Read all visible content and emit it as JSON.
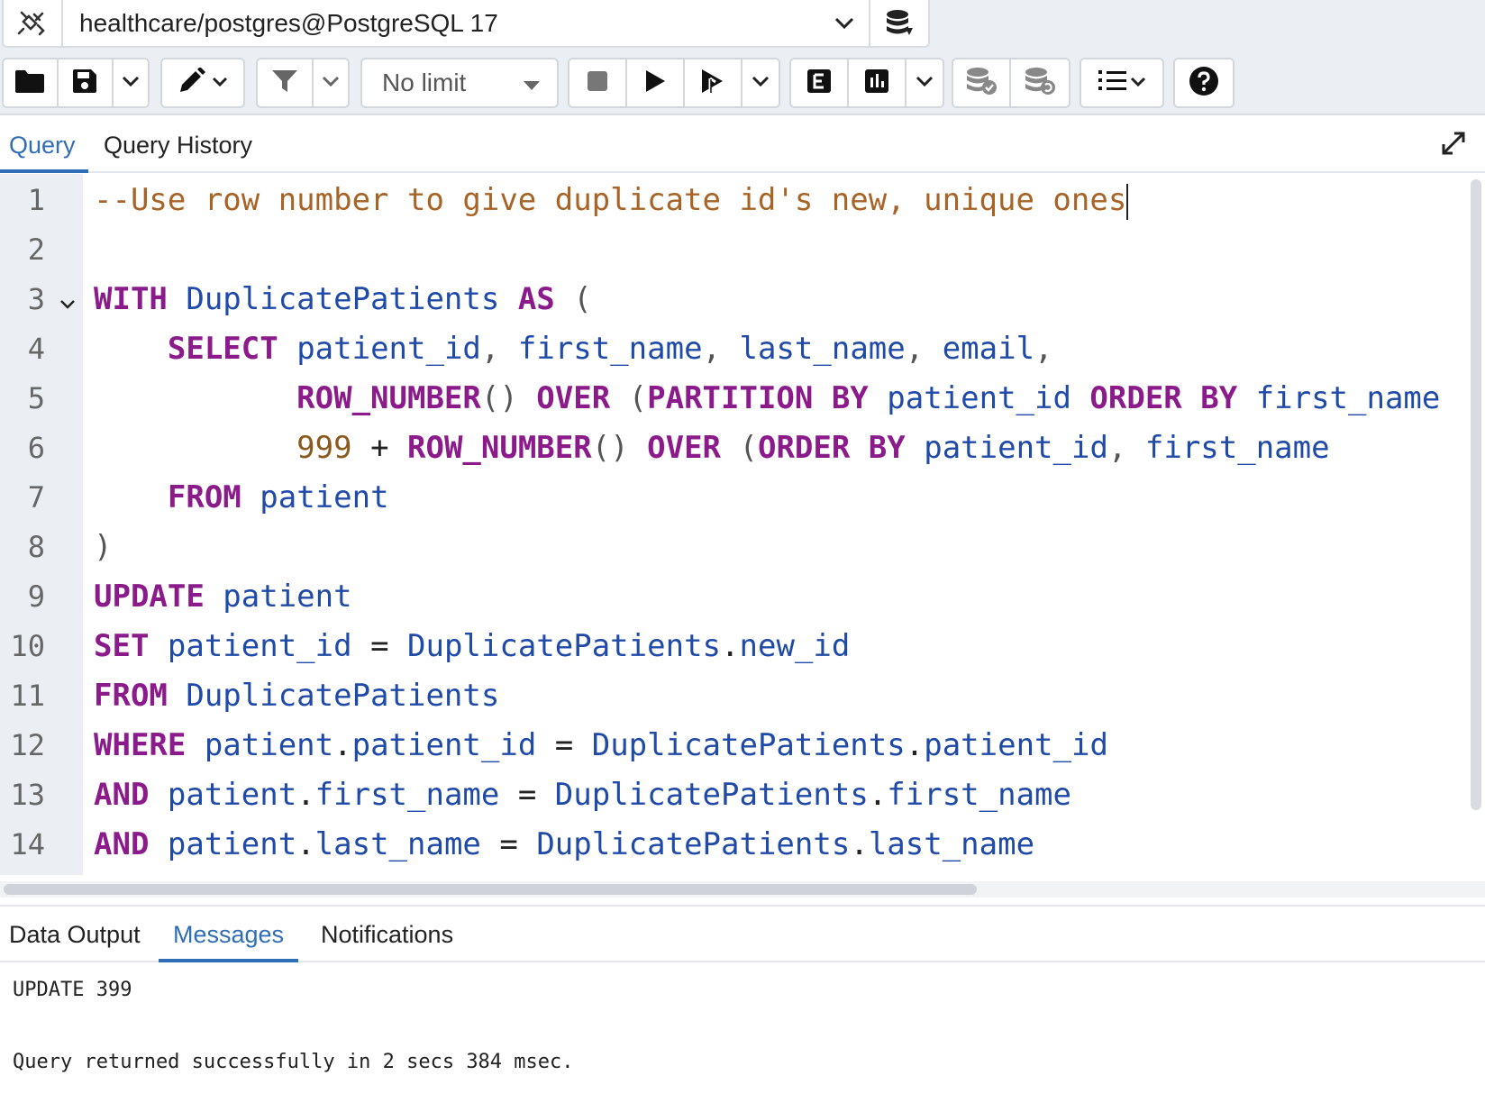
{
  "connection": {
    "label": "healthcare/postgres@PostgreSQL 17",
    "icon": "plug-disconnected-icon"
  },
  "toolbar": {
    "limit_label": "No limit"
  },
  "query_tabs": [
    {
      "label": "Query",
      "active": true
    },
    {
      "label": "Query History",
      "active": false
    }
  ],
  "editor": {
    "line_numbers": [
      "1",
      "2",
      "3",
      "4",
      "5",
      "6",
      "7",
      "8",
      "9",
      "10",
      "11",
      "12",
      "13",
      "14"
    ],
    "lines": [
      [
        {
          "t": "cm",
          "v": "--Use row number to give duplicate id's new, unique ones"
        }
      ],
      [],
      [
        {
          "t": "kw",
          "v": "WITH"
        },
        {
          "t": "id",
          "v": " DuplicatePatients "
        },
        {
          "t": "kw",
          "v": "AS"
        },
        {
          "t": "pn",
          "v": " ("
        }
      ],
      [
        {
          "t": "id",
          "v": "    "
        },
        {
          "t": "kw",
          "v": "SELECT"
        },
        {
          "t": "id",
          "v": " patient_id"
        },
        {
          "t": "pn",
          "v": ","
        },
        {
          "t": "id",
          "v": " first_name"
        },
        {
          "t": "pn",
          "v": ","
        },
        {
          "t": "id",
          "v": " last_name"
        },
        {
          "t": "pn",
          "v": ","
        },
        {
          "t": "id",
          "v": " email"
        },
        {
          "t": "pn",
          "v": ","
        }
      ],
      [
        {
          "t": "id",
          "v": "           "
        },
        {
          "t": "kw",
          "v": "ROW_NUMBER"
        },
        {
          "t": "pn",
          "v": "() "
        },
        {
          "t": "kw",
          "v": "OVER"
        },
        {
          "t": "pn",
          "v": " ("
        },
        {
          "t": "kw",
          "v": "PARTITION BY"
        },
        {
          "t": "id",
          "v": " patient_id "
        },
        {
          "t": "kw",
          "v": "ORDER BY"
        },
        {
          "t": "id",
          "v": " first_name"
        }
      ],
      [
        {
          "t": "id",
          "v": "           "
        },
        {
          "t": "nm",
          "v": "999"
        },
        {
          "t": "op",
          "v": " + "
        },
        {
          "t": "kw",
          "v": "ROW_NUMBER"
        },
        {
          "t": "pn",
          "v": "() "
        },
        {
          "t": "kw",
          "v": "OVER"
        },
        {
          "t": "pn",
          "v": " ("
        },
        {
          "t": "kw",
          "v": "ORDER BY"
        },
        {
          "t": "id",
          "v": " patient_id"
        },
        {
          "t": "pn",
          "v": ","
        },
        {
          "t": "id",
          "v": " first_name"
        }
      ],
      [
        {
          "t": "id",
          "v": "    "
        },
        {
          "t": "kw",
          "v": "FROM"
        },
        {
          "t": "id",
          "v": " patient"
        }
      ],
      [
        {
          "t": "pn",
          "v": ")"
        }
      ],
      [
        {
          "t": "kw",
          "v": "UPDATE"
        },
        {
          "t": "id",
          "v": " patient"
        }
      ],
      [
        {
          "t": "kw",
          "v": "SET"
        },
        {
          "t": "id",
          "v": " patient_id "
        },
        {
          "t": "op",
          "v": "="
        },
        {
          "t": "id",
          "v": " DuplicatePatients"
        },
        {
          "t": "op",
          "v": "."
        },
        {
          "t": "id",
          "v": "new_id"
        }
      ],
      [
        {
          "t": "kw",
          "v": "FROM"
        },
        {
          "t": "id",
          "v": " DuplicatePatients"
        }
      ],
      [
        {
          "t": "kw",
          "v": "WHERE"
        },
        {
          "t": "id",
          "v": " patient"
        },
        {
          "t": "op",
          "v": "."
        },
        {
          "t": "id",
          "v": "patient_id "
        },
        {
          "t": "op",
          "v": "="
        },
        {
          "t": "id",
          "v": " DuplicatePatients"
        },
        {
          "t": "op",
          "v": "."
        },
        {
          "t": "id",
          "v": "patient_id"
        }
      ],
      [
        {
          "t": "kw",
          "v": "AND"
        },
        {
          "t": "id",
          "v": " patient"
        },
        {
          "t": "op",
          "v": "."
        },
        {
          "t": "id",
          "v": "first_name "
        },
        {
          "t": "op",
          "v": "="
        },
        {
          "t": "id",
          "v": " DuplicatePatients"
        },
        {
          "t": "op",
          "v": "."
        },
        {
          "t": "id",
          "v": "first_name"
        }
      ],
      [
        {
          "t": "kw",
          "v": "AND"
        },
        {
          "t": "id",
          "v": " patient"
        },
        {
          "t": "op",
          "v": "."
        },
        {
          "t": "id",
          "v": "last_name "
        },
        {
          "t": "op",
          "v": "="
        },
        {
          "t": "id",
          "v": " DuplicatePatients"
        },
        {
          "t": "op",
          "v": "."
        },
        {
          "t": "id",
          "v": "last_name"
        }
      ]
    ]
  },
  "output_tabs": [
    {
      "label": "Data Output",
      "active": false
    },
    {
      "label": "Messages",
      "active": true
    },
    {
      "label": "Notifications",
      "active": false
    }
  ],
  "messages": {
    "line1": "UPDATE 399",
    "line2": "Query returned successfully in 2 secs 384 msec."
  },
  "colors": {
    "accent": "#2f6db5",
    "keyword": "#8b1a8b",
    "identifier": "#1f4aa8",
    "comment": "#a86427",
    "number": "#8a5a1c"
  }
}
